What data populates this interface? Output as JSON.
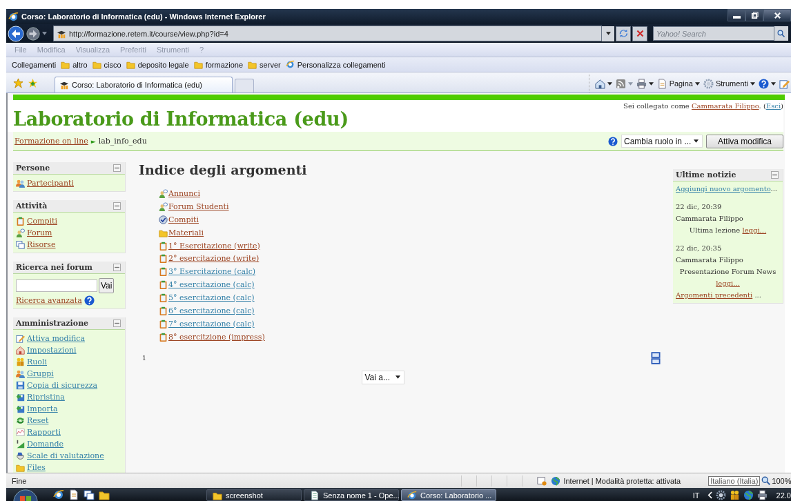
{
  "window": {
    "title": "Corso: Laboratorio di Informatica (edu) - Windows Internet Explorer"
  },
  "address_bar": {
    "value": "http://formazione.retem.it/course/view.php?id=4"
  },
  "search": {
    "placeholder": "Yahoo! Search"
  },
  "menu": [
    {
      "label": "File"
    },
    {
      "label": "Modifica"
    },
    {
      "label": "Visualizza"
    },
    {
      "label": "Preferiti"
    },
    {
      "label": "Strumenti"
    },
    {
      "label": "?"
    }
  ],
  "links_bar": {
    "label": "Collegamenti",
    "items": [
      {
        "label": "altro",
        "kind": "folder"
      },
      {
        "label": "cisco",
        "kind": "folder"
      },
      {
        "label": "deposito legale",
        "kind": "folder"
      },
      {
        "label": "formazione",
        "kind": "folder"
      },
      {
        "label": "server",
        "kind": "folder"
      },
      {
        "label": "Personalizza collegamenti",
        "kind": "page"
      }
    ]
  },
  "tabs": [
    {
      "label": "Corso: Laboratorio di Informatica (edu)",
      "selected": true
    }
  ],
  "command_bar": [
    {
      "label": "Pagina",
      "kind": "page"
    },
    {
      "label": "Strumenti",
      "kind": "gear"
    }
  ],
  "page": {
    "course_title": "Laboratorio di Informatica (edu)",
    "login": {
      "prefix": "Sei collegato come ",
      "user": {
        "label": "Cammarata Filippo",
        "visited": true
      },
      "middle": ". (",
      "logout": {
        "label": "Esci",
        "visited": false
      },
      "suffix": ")"
    },
    "breadcrumb": {
      "home": {
        "label": "Formazione on line",
        "visited": true
      },
      "separator": "►",
      "current": "lab_info_edu"
    },
    "role_select": "Cambia ruolo in ...",
    "edit_button": "Attiva modifica",
    "left_blocks": [
      {
        "title": "Persone",
        "kind": "links",
        "items": [
          {
            "label": "Partecipanti",
            "kind": "people",
            "visited": true
          }
        ]
      },
      {
        "title": "Attività",
        "kind": "links",
        "items": [
          {
            "label": "Compiti",
            "kind": "clipboard",
            "visited": true
          },
          {
            "label": "Forum",
            "kind": "forum",
            "visited": true
          },
          {
            "label": "Risorse",
            "kind": "pages",
            "visited": true
          }
        ]
      },
      {
        "title": "Ricerca nei forum",
        "kind": "search",
        "button": "Vai",
        "advanced": {
          "label": "Ricerca avanzata",
          "visited": true
        }
      },
      {
        "title": "Amministrazione",
        "kind": "links",
        "items": [
          {
            "label": "Attiva modifica",
            "kind": "pencil",
            "visited": false
          },
          {
            "label": "Impostazioni",
            "kind": "house",
            "visited": false
          },
          {
            "label": "Ruoli",
            "kind": "figures",
            "visited": false
          },
          {
            "label": "Gruppi",
            "kind": "people",
            "visited": false
          },
          {
            "label": "Copia di sicurezza",
            "kind": "floppy",
            "visited": false
          },
          {
            "label": "Ripristina",
            "kind": "floppy_arrow",
            "visited": false
          },
          {
            "label": "Importa",
            "kind": "floppy_arrow",
            "visited": false
          },
          {
            "label": "Reset",
            "kind": "refresh",
            "visited": false
          },
          {
            "label": "Rapporti",
            "kind": "chart",
            "visited": false
          },
          {
            "label": "Domande",
            "kind": "ramp",
            "visited": false
          },
          {
            "label": "Scale di valutazione",
            "kind": "bowl",
            "visited": false
          },
          {
            "label": "Files",
            "kind": "folder",
            "visited": false
          }
        ]
      }
    ],
    "topics": {
      "heading": "Indice degli argomenti",
      "items": [
        {
          "label": " Annunci",
          "kind": "forum",
          "visited": true
        },
        {
          "label": " Forum Studenti",
          "kind": "forum",
          "visited": true
        },
        {
          "label": " Compiti",
          "kind": "check_disc",
          "visited": true
        },
        {
          "label": "Materiali",
          "kind": "folder",
          "visited": true
        },
        {
          "label": "1° Esercitazione (write)",
          "kind": "clipboard",
          "visited": true
        },
        {
          "label": "2° esercitazione (write)",
          "kind": "clipboard",
          "visited": true
        },
        {
          "label": "3° Esercitazione (calc)",
          "kind": "clipboard",
          "visited": false
        },
        {
          "label": "4° esercitazione (calc)",
          "kind": "clipboard",
          "visited": false
        },
        {
          "label": "5° esercitazione (calc)",
          "kind": "clipboard",
          "visited": false
        },
        {
          "label": "6° esercitazione (calc)",
          "kind": "clipboard",
          "visited": false
        },
        {
          "label": "7° esercitazione (calc)",
          "kind": "clipboard",
          "visited": false
        },
        {
          "label": "8° esercitzione (impress)",
          "kind": "clipboard",
          "visited": true
        }
      ],
      "section_number": "1",
      "jump_select": "Vai a..."
    },
    "news": {
      "title": "Ultime notizie",
      "add": {
        "label": "Aggiungi nuovo argomento",
        "visited": false
      },
      "add_suffix": "...",
      "posts": [
        {
          "date": "22 dic, 20:39",
          "author": "Cammarata Filippo",
          "subject": "Ultima lezione ",
          "more": {
            "label": "leggi...",
            "visited": true
          }
        },
        {
          "date": "22 dic, 20:35",
          "author": "Cammarata Filippo",
          "subject": "Presentazione Forum News ",
          "more": {
            "label": "leggi...",
            "visited": true
          }
        }
      ],
      "older": {
        "label": "Argomenti precedenti",
        "visited": true
      },
      "older_suffix": " ..."
    }
  },
  "status_bar": {
    "text": "Fine",
    "zone": "Internet | Modalità protetta: attivata",
    "tooltip": "Italiano (Italia)",
    "zoom": "100%"
  },
  "taskbar": {
    "buttons": [
      {
        "label": "screenshot",
        "kind": "folder",
        "selected": false
      },
      {
        "label": "Senza nome 1 - Ope...",
        "kind": "document",
        "selected": false
      },
      {
        "label": "Corso: Laboratorio ...",
        "kind": "browser",
        "selected": true
      }
    ],
    "language": "IT",
    "clock": "22.0"
  }
}
